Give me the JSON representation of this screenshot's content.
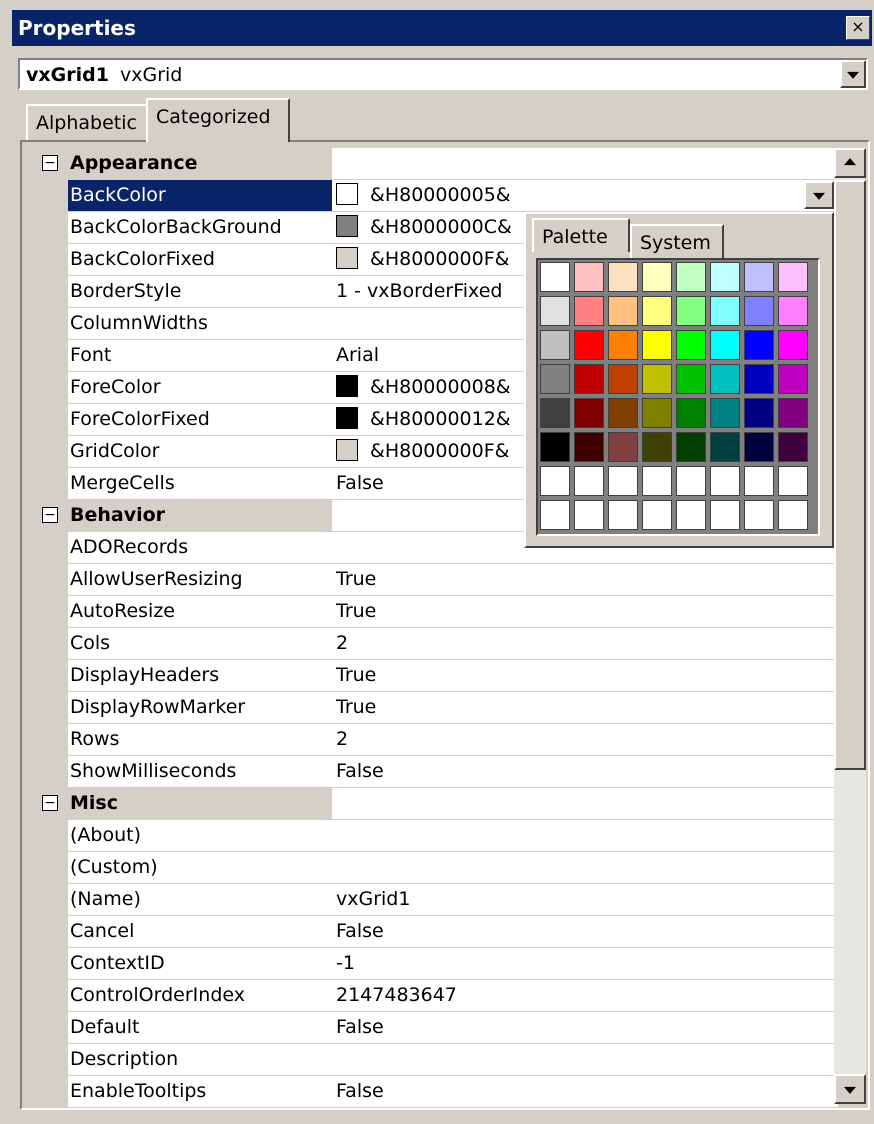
{
  "window": {
    "title": "Properties",
    "close_glyph": "×"
  },
  "object_combo": {
    "name": "vxGrid1",
    "type": "vxGrid"
  },
  "tabs": [
    {
      "label": "Alphabetic"
    },
    {
      "label": "Categorized"
    }
  ],
  "categories": [
    {
      "name": "Appearance",
      "toggle": "−"
    },
    {
      "name": "Behavior",
      "toggle": "−"
    },
    {
      "name": "Misc",
      "toggle": "−"
    }
  ],
  "appearance": [
    {
      "name": "BackColor",
      "value": "&H80000005&",
      "swatch": "#ffffff"
    },
    {
      "name": "BackColorBackGround",
      "value": "&H8000000C&",
      "swatch": "#808080"
    },
    {
      "name": "BackColorFixed",
      "value": "&H8000000F&",
      "swatch": "#d4d0c8"
    },
    {
      "name": "BorderStyle",
      "value": "1 - vxBorderFixed"
    },
    {
      "name": "ColumnWidths",
      "value": ""
    },
    {
      "name": "Font",
      "value": "Arial"
    },
    {
      "name": "ForeColor",
      "value": "&H80000008&",
      "swatch": "#000000"
    },
    {
      "name": "ForeColorFixed",
      "value": "&H80000012&",
      "swatch": "#000000"
    },
    {
      "name": "GridColor",
      "value": "&H8000000F&",
      "swatch": "#d4d0c8"
    },
    {
      "name": "MergeCells",
      "value": "False"
    }
  ],
  "behavior": [
    {
      "name": "ADORecords",
      "value": ""
    },
    {
      "name": "AllowUserResizing",
      "value": "True"
    },
    {
      "name": "AutoResize",
      "value": "True"
    },
    {
      "name": "Cols",
      "value": "2"
    },
    {
      "name": "DisplayHeaders",
      "value": "True"
    },
    {
      "name": "DisplayRowMarker",
      "value": "True"
    },
    {
      "name": "Rows",
      "value": "2"
    },
    {
      "name": "ShowMilliseconds",
      "value": "False"
    }
  ],
  "misc": [
    {
      "name": "(About)",
      "value": ""
    },
    {
      "name": "(Custom)",
      "value": ""
    },
    {
      "name": "(Name)",
      "value": "vxGrid1"
    },
    {
      "name": "Cancel",
      "value": "False"
    },
    {
      "name": "ContextID",
      "value": "-1"
    },
    {
      "name": "ControlOrderIndex",
      "value": "2147483647"
    },
    {
      "name": "Default",
      "value": "False"
    },
    {
      "name": "Description",
      "value": ""
    },
    {
      "name": "EnableTooltips",
      "value": "False"
    }
  ],
  "color_popup": {
    "tabs": [
      {
        "label": "Palette"
      },
      {
        "label": "System"
      }
    ],
    "palette_colors": [
      "#ffffff",
      "#ffc0c0",
      "#ffe0c0",
      "#ffffc0",
      "#c0ffc0",
      "#c0ffff",
      "#c0c0ff",
      "#ffc0ff",
      "#e0e0e0",
      "#ff8080",
      "#ffc080",
      "#ffff80",
      "#80ff80",
      "#80ffff",
      "#8080ff",
      "#ff80ff",
      "#c0c0c0",
      "#ff0000",
      "#ff8000",
      "#ffff00",
      "#00ff00",
      "#00ffff",
      "#0000ff",
      "#ff00ff",
      "#808080",
      "#c00000",
      "#c04000",
      "#c0c000",
      "#00c000",
      "#00c0c0",
      "#0000c0",
      "#c000c0",
      "#404040",
      "#800000",
      "#804000",
      "#808000",
      "#008000",
      "#008080",
      "#000080",
      "#800080",
      "#000000",
      "#400000",
      "#804040",
      "#404000",
      "#004000",
      "#004040",
      "#000040",
      "#400040",
      "#ffffff",
      "#ffffff",
      "#ffffff",
      "#ffffff",
      "#ffffff",
      "#ffffff",
      "#ffffff",
      "#ffffff",
      "#ffffff",
      "#ffffff",
      "#ffffff",
      "#ffffff",
      "#ffffff",
      "#ffffff",
      "#ffffff",
      "#ffffff"
    ]
  },
  "colors": {
    "titlebar": "#0a246a",
    "selection": "#0a246a",
    "face": "#d4d0c8"
  }
}
